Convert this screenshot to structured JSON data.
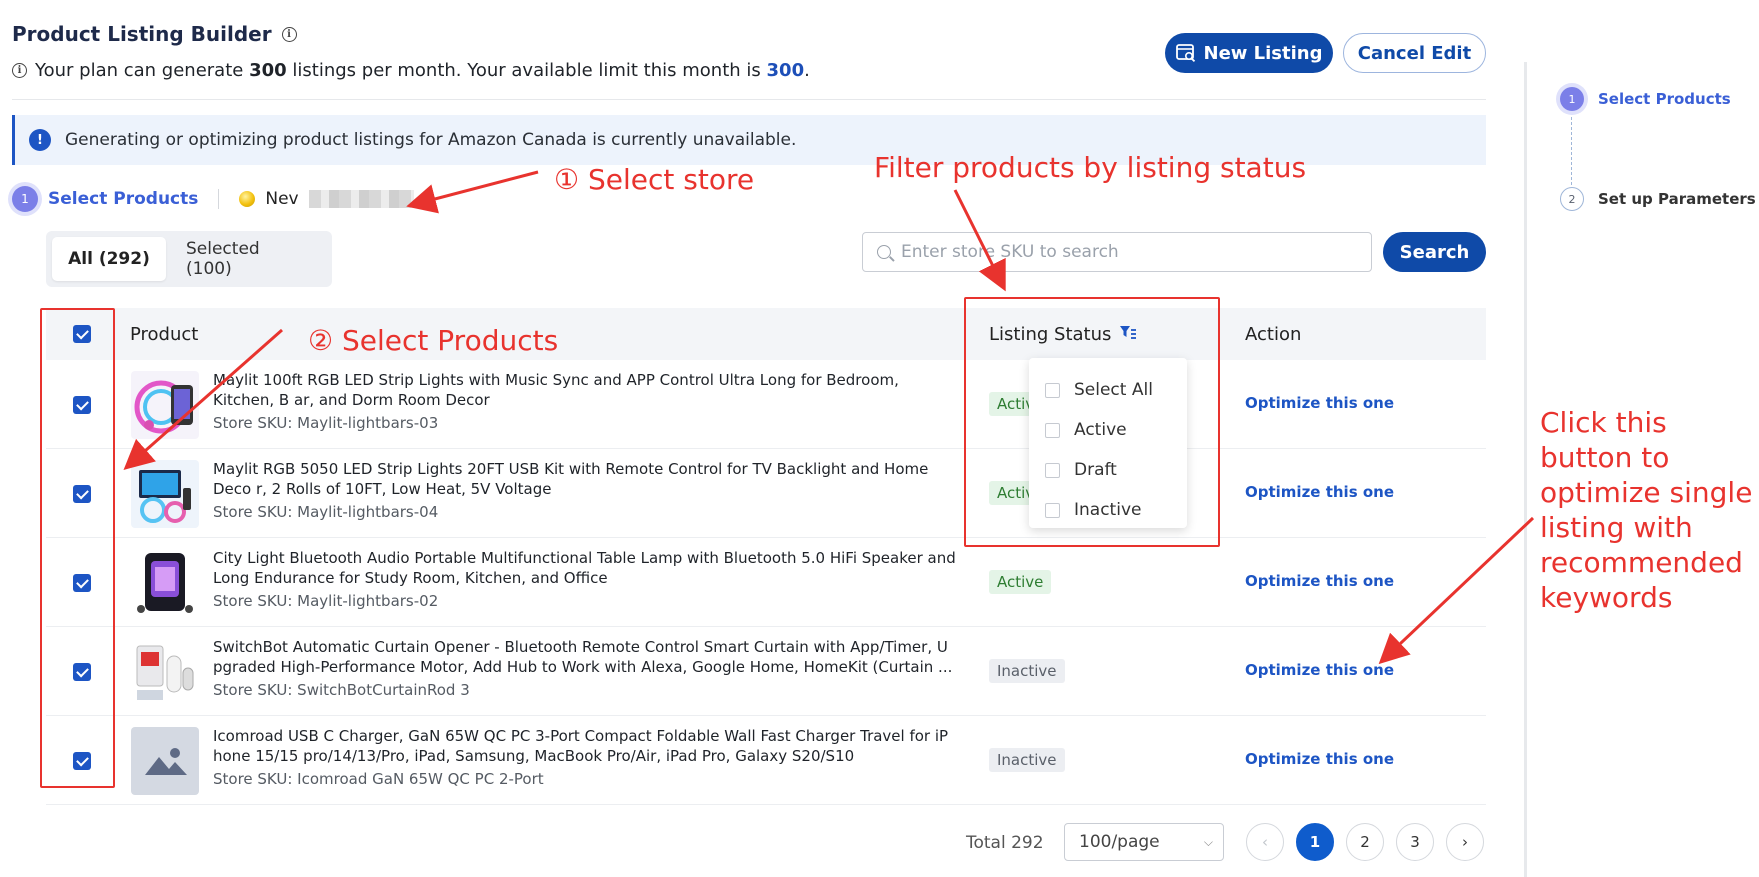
{
  "header": {
    "title": "Product Listing Builder",
    "plan_prefix": "Your plan can generate",
    "plan_count": "300",
    "plan_middle": "listings per month. Your available limit this month is",
    "plan_limit": "300",
    "plan_suffix": ".",
    "new_listing_label": "New Listing",
    "cancel_edit_label": "Cancel Edit"
  },
  "alert": {
    "text": "Generating or optimizing product listings for Amazon Canada is currently unavailable."
  },
  "stepbar": {
    "step_number": "1",
    "step_label": "Select Products",
    "store_name": "Nev"
  },
  "tabs": {
    "all": "All (292)",
    "selected": "Selected (100)"
  },
  "search": {
    "placeholder": "Enter store SKU to search",
    "button_label": "Search"
  },
  "table": {
    "columns": {
      "product": "Product",
      "status": "Listing Status",
      "action": "Action"
    },
    "rows": [
      {
        "name": "Maylit 100ft RGB LED Strip Lights with Music Sync and APP Control Ultra Long for Bedroom, Kitchen, B ar, and Dorm Room Decor",
        "sku": "Store SKU: Maylit-lightbars-03",
        "status": "Active",
        "action": "Optimize this one"
      },
      {
        "name": "Maylit RGB 5050 LED Strip Lights 20FT USB Kit with Remote Control for TV Backlight and Home Deco r, 2 Rolls of 10FT, Low Heat, 5V Voltage",
        "sku": "Store SKU: Maylit-lightbars-04",
        "status": "Active",
        "action": "Optimize this one"
      },
      {
        "name": "City Light Bluetooth Audio Portable Multifunctional Table Lamp with Bluetooth 5.0 HiFi Speaker and Long Endurance for Study Room, Kitchen, and Office",
        "sku": "Store SKU: Maylit-lightbars-02",
        "status": "Active",
        "action": "Optimize this one"
      },
      {
        "name": "SwitchBot Automatic Curtain Opener - Bluetooth Remote Control Smart Curtain with App/Timer, U pgraded High-Performance Motor, Add Hub to Work with Alexa, Google Home, HomeKit (Curtain ...",
        "sku": "Store SKU: SwitchBotCurtainRod 3",
        "status": "Inactive",
        "action": "Optimize this one"
      },
      {
        "name": "Icomroad USB C Charger, GaN 65W QC PC 3-Port Compact Foldable Wall Fast Charger Travel for iP hone 15/15 pro/14/13/Pro, iPad, Samsung, MacBook Pro/Air, iPad Pro, Galaxy S20/S10",
        "sku": "Store SKU: Icomroad GaN 65W QC PC 2-Port",
        "status": "Inactive",
        "action": "Optimize this one"
      }
    ]
  },
  "status_filter": {
    "options": [
      "Select All",
      "Active",
      "Draft",
      "Inactive"
    ]
  },
  "pagination": {
    "total": "Total 292",
    "per_page": "100/page",
    "pages": [
      "1",
      "2",
      "3"
    ],
    "current_page": "1"
  },
  "right_steps": [
    {
      "number": "1",
      "label": "Select Products"
    },
    {
      "number": "2",
      "label": "Set up Parameters"
    }
  ],
  "annotations": {
    "select_store": "① Select store",
    "filter_status": "Filter products by listing status",
    "select_products": "② Select Products",
    "optimize_hint": [
      "Click this",
      "button to",
      "optimize single",
      "listing with",
      "recommended",
      "keywords"
    ]
  },
  "colors": {
    "primary": "#0f4aa8",
    "accent_purple": "#7b7fe8",
    "annotation_red": "#e8332e",
    "active_green": "#2e7d32"
  }
}
